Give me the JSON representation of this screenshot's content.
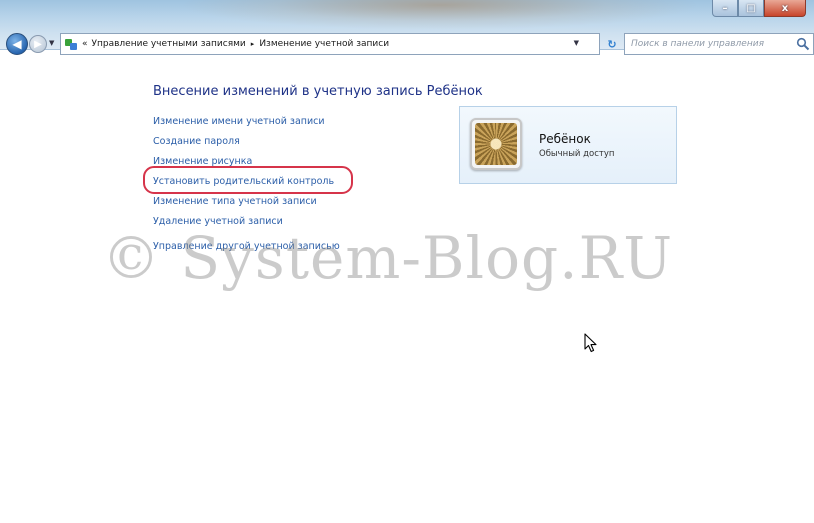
{
  "window": {
    "controls": {
      "minimize": "–",
      "maximize": "□",
      "close": "x"
    }
  },
  "navigation": {
    "back": "◀",
    "forward": "▶",
    "breadcrumb_prefix": "«",
    "breadcrumbs": [
      "Управление учетными записями",
      "Изменение учетной записи"
    ],
    "separator": "▸",
    "search_placeholder": "Поиск в панели управления"
  },
  "main": {
    "title": "Внесение изменений в учетную запись Ребёнок",
    "tasks": [
      "Изменение имени учетной записи",
      "Создание пароля",
      "Изменение рисунка",
      "Установить родительский контроль",
      "Изменение типа учетной записи",
      "Удаление учетной записи"
    ],
    "other_link": "Управление другой учетной записью"
  },
  "account": {
    "name": "Ребёнок",
    "type": "Обычный доступ"
  },
  "watermark": "© System-Blog.RU",
  "colors": {
    "link": "#2b5ea8",
    "title": "#1e3287",
    "highlight": "#d6344a",
    "card_border": "#b7d1e8"
  }
}
